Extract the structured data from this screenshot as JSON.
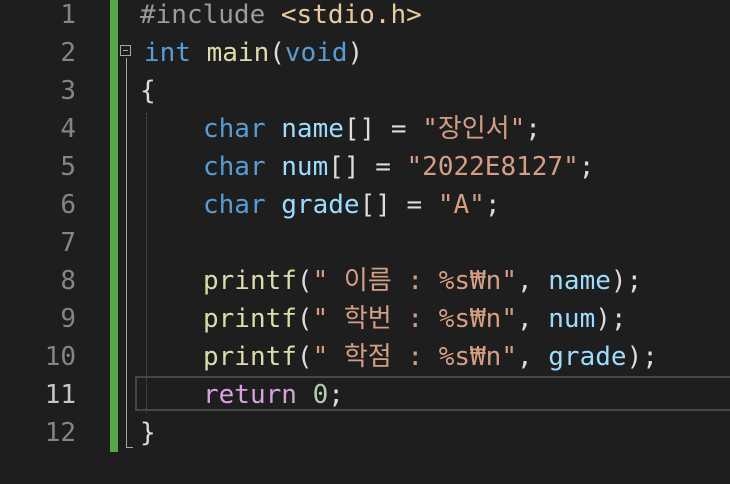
{
  "editor": {
    "line_numbers": [
      "1",
      "2",
      "3",
      "4",
      "5",
      "6",
      "7",
      "8",
      "9",
      "10",
      "11",
      "12"
    ],
    "current_line": "11",
    "lines": {
      "l1": {
        "pre": "#include",
        "space": " ",
        "header": "<stdio.h>"
      },
      "l2": {
        "kw": "int",
        "space": " ",
        "fn": "main",
        "open": "(",
        "param": "void",
        "close": ")"
      },
      "l3": {
        "brace": "{"
      },
      "l4": {
        "kw": "char",
        "space": " ",
        "var": "name",
        "rest": "[] = ",
        "str": "\"장인서\"",
        "semi": ";"
      },
      "l5": {
        "kw": "char",
        "space": " ",
        "var": "num",
        "rest": "[] = ",
        "str": "\"2022E8127\"",
        "semi": ";"
      },
      "l6": {
        "kw": "char",
        "space": " ",
        "var": "grade",
        "rest": "[] = ",
        "str": "\"A\"",
        "semi": ";"
      },
      "l8": {
        "fn": "printf",
        "open": "(",
        "str1": "\" 이름 : ",
        "fmt": "%s₩n",
        "str2": "\"",
        "comma": ", ",
        "var": "name",
        "close": ");"
      },
      "l9": {
        "fn": "printf",
        "open": "(",
        "str1": "\" 학번 : ",
        "fmt": "%s₩n",
        "str2": "\"",
        "comma": ", ",
        "var": "num",
        "close": ");"
      },
      "l10": {
        "fn": "printf",
        "open": "(",
        "str1": "\" 학점 : ",
        "fmt": "%s₩n",
        "str2": "\"",
        "comma": ", ",
        "var": "grade",
        "close": ");"
      },
      "l11": {
        "ctl": "return",
        "space": " ",
        "num": "0",
        "semi": ";"
      },
      "l12": {
        "brace": "}"
      }
    }
  },
  "colors": {
    "background": "#1e1e1e",
    "change_bar": "#57a64a",
    "keyword": "#569cd6",
    "function": "#dcdcaa",
    "string": "#d69d85",
    "variable": "#9cdcfe",
    "control": "#d8a0df"
  }
}
